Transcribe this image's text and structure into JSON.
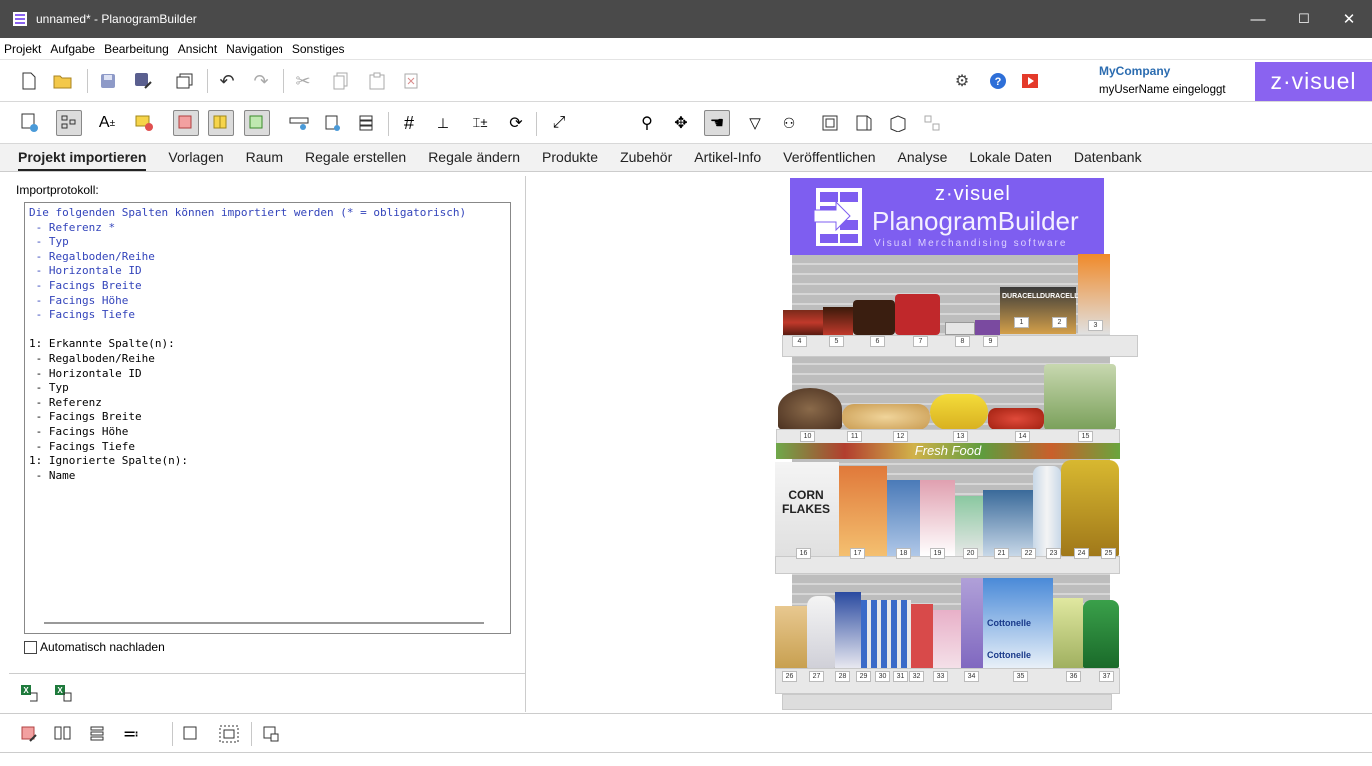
{
  "window": {
    "title": "unnamed* - PlanogramBuilder",
    "minimize": "—",
    "maximize": "☐",
    "close": "✕"
  },
  "menu": [
    "Projekt",
    "Aufgabe",
    "Bearbeitung",
    "Ansicht",
    "Navigation",
    "Sonstiges"
  ],
  "header": {
    "company": "MyCompany",
    "user": "myUserName eingeloggt",
    "brand": "z·visuel"
  },
  "tabs": [
    "Projekt importieren",
    "Vorlagen",
    "Raum",
    "Regale erstellen",
    "Regale ändern",
    "Produkte",
    "Zubehör",
    "Artikel-Info",
    "Veröffentlichen",
    "Analyse",
    "Lokale Daten",
    "Datenbank"
  ],
  "left": {
    "label": "Importprotokoll:",
    "autoload": "Automatisch nachladen",
    "log_blue": [
      "Die folgenden Spalten können importiert werden (* = obligatorisch)",
      " - Referenz *",
      " - Typ",
      " - Regalboden/Reihe",
      " - Horizontale ID",
      " - Facings Breite",
      " - Facings Höhe",
      " - Facings Tiefe"
    ],
    "log_black": [
      "",
      "1: Erkannte Spalte(n):",
      " - Regalboden/Reihe",
      " - Horizontale ID",
      " - Typ",
      " - Referenz",
      " - Facings Breite",
      " - Facings Höhe",
      " - Facings Tiefe",
      "1: Ignorierte Spalte(n):",
      " - Name"
    ]
  },
  "banner": {
    "brand": "z·visuel",
    "product": "PlanogramBuilder",
    "tagline": "Visual Merchandising software"
  },
  "shelf": {
    "fresh_label": "Fresh Food",
    "labels": [
      "1",
      "2",
      "3",
      "4",
      "5",
      "6",
      "7",
      "8",
      "9",
      "10",
      "11",
      "12",
      "13",
      "14",
      "15",
      "16",
      "17",
      "18",
      "19",
      "20",
      "21",
      "22",
      "23",
      "24",
      "25",
      "26",
      "27",
      "28",
      "29",
      "30",
      "31",
      "32",
      "33",
      "34",
      "35",
      "36",
      "37"
    ],
    "brands": [
      "DURACELL",
      "DURACELL",
      "CORN FLAKES",
      "Cottonelle",
      "Cottonelle"
    ]
  },
  "colors": {
    "titlebar": "#4a4a4a",
    "brand": "#8a63f0",
    "link": "#2b6cb0",
    "log_blue": "#3344bb"
  }
}
